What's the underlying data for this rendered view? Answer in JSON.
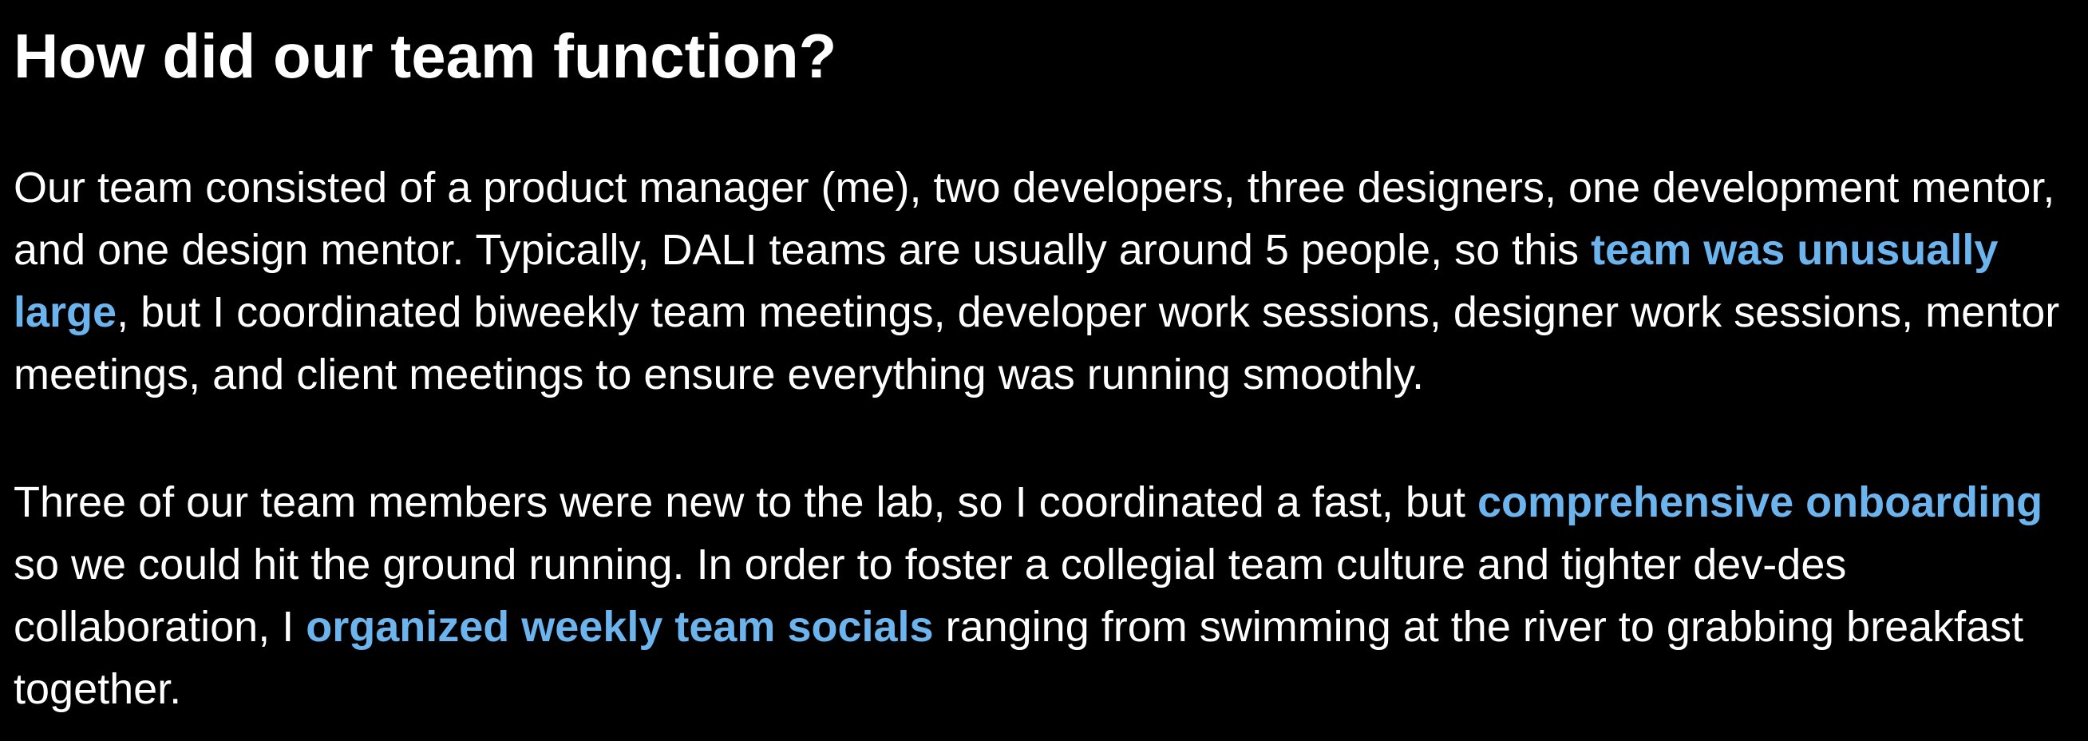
{
  "heading": "How did our team function?",
  "colors": {
    "background": "#000000",
    "text": "#ffffff",
    "highlight": "#6cb4ee"
  },
  "paragraphs": [
    {
      "t1": "Our team consisted of a product manager (me), two developers, three designers, one development mentor, and one design mentor. Typically, DALI teams are usually around 5 people, so this ",
      "h1": "team was unusually large",
      "t2": ", but I coordinated biweekly team meetings, developer work sessions, designer work sessions, mentor meetings, and client meetings to ensure everything was running smoothly."
    },
    {
      "t1": "Three of our team members were new to the lab, so I coordinated a fast, but ",
      "h1": "comprehensive onboarding",
      "t2": " so we could hit the ground running. In order to foster a collegial team culture and tighter dev-des collaboration, I ",
      "h2": "organized weekly team socials",
      "t3": " ranging from swimming at the river to grabbing breakfast together."
    }
  ]
}
